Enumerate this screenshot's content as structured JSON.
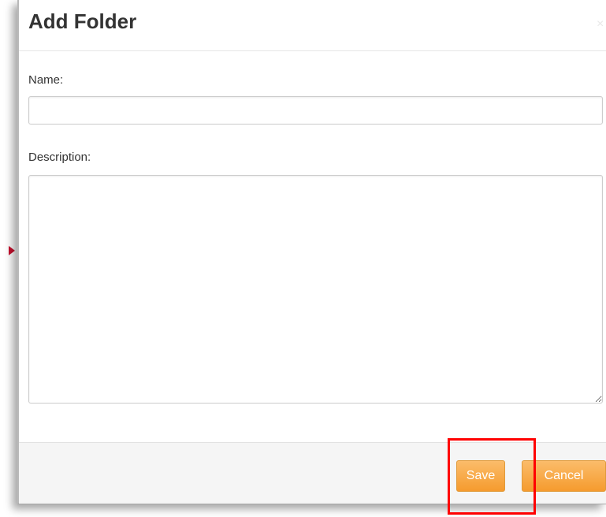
{
  "dialog": {
    "title": "Add Folder",
    "close_icon": "close-icon",
    "close_glyph": "×"
  },
  "form": {
    "name_label": "Name:",
    "name_value": "",
    "description_label": "Description:",
    "description_value": ""
  },
  "footer": {
    "save_label": "Save",
    "cancel_label": "Cancel"
  },
  "colors": {
    "accent": "#f7a13d",
    "highlight": "#ff0000"
  }
}
